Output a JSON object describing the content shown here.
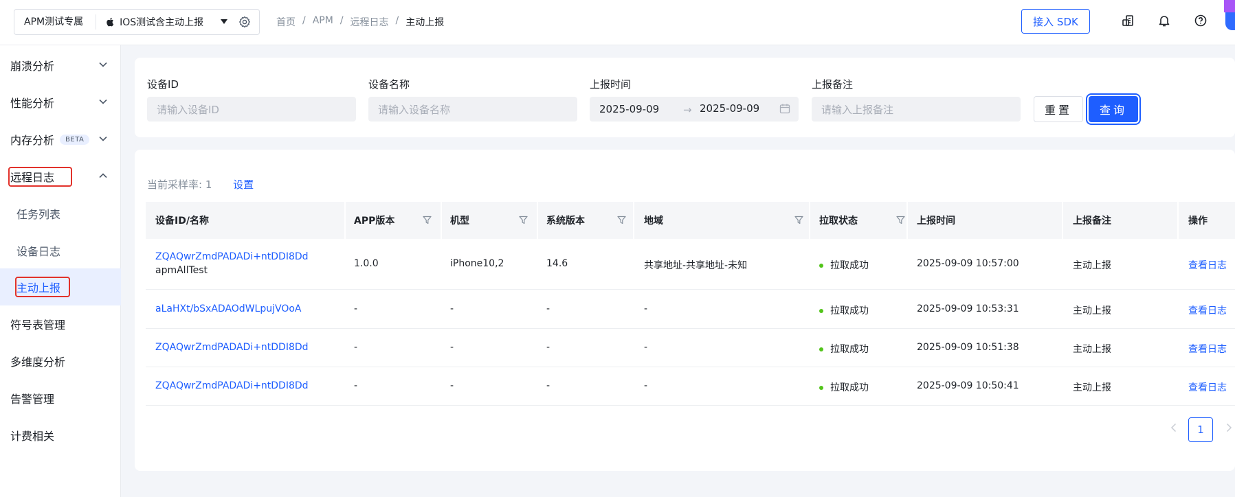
{
  "topbar": {
    "project": "APM测试专属",
    "app_name": "IOS测试含主动上报",
    "breadcrumbs": [
      "首页",
      "APM",
      "远程日志",
      "主动上报"
    ],
    "separator": "/",
    "sdk_button": "接入 SDK",
    "icons": [
      "coins-icon",
      "bell-icon",
      "help-icon"
    ]
  },
  "sidebar": {
    "items": [
      {
        "label": "崩溃分析",
        "expanded": false
      },
      {
        "label": "性能分析",
        "expanded": false
      },
      {
        "label": "内存分析",
        "badge": "BETA",
        "expanded": false
      },
      {
        "label": "远程日志",
        "expanded": true
      },
      {
        "label": "任务列表",
        "sub": true
      },
      {
        "label": "设备日志",
        "sub": true
      },
      {
        "label": "主动上报",
        "sub": true,
        "active": true
      },
      {
        "label": "符号表管理"
      },
      {
        "label": "多维度分析"
      },
      {
        "label": "告警管理"
      },
      {
        "label": "计费相关"
      }
    ]
  },
  "filter": {
    "device_id_label": "设备ID",
    "device_id_placeholder": "请输入设备ID",
    "device_name_label": "设备名称",
    "device_name_placeholder": "请输入设备名称",
    "time_label": "上报时间",
    "date_start": "2025-09-09",
    "date_arrow": "→",
    "date_end": "2025-09-09",
    "remark_label": "上报备注",
    "remark_placeholder": "请输入上报备注",
    "reset_button": "重置",
    "query_button": "查询"
  },
  "table": {
    "rate_label": "当前采样率:",
    "rate_value": "1",
    "rate_setting": "设置",
    "columns": [
      "设备ID/名称",
      "APP版本",
      "机型",
      "系统版本",
      "地域",
      "拉取状态",
      "上报时间",
      "上报备注",
      "操作"
    ],
    "rows": [
      {
        "device_id": "ZQAQwrZmdPADADi+ntDDI8Dd",
        "device_name": "apmAllTest",
        "app_version": "1.0.0",
        "model": "iPhone10,2",
        "os_version": "14.6",
        "region": "共享地址-共享地址-未知",
        "status": "拉取成功",
        "time": "2025-09-09 10:57:00",
        "remark": "主动上报",
        "action": "查看日志"
      },
      {
        "device_id": "aLaHXt/bSxADAOdWLpujVOoA",
        "device_name": "",
        "app_version": "-",
        "model": "-",
        "os_version": "-",
        "region": "-",
        "status": "拉取成功",
        "time": "2025-09-09 10:53:31",
        "remark": "主动上报",
        "action": "查看日志"
      },
      {
        "device_id": "ZQAQwrZmdPADADi+ntDDI8Dd",
        "device_name": "",
        "app_version": "-",
        "model": "-",
        "os_version": "-",
        "region": "-",
        "status": "拉取成功",
        "time": "2025-09-09 10:51:38",
        "remark": "主动上报",
        "action": "查看日志"
      },
      {
        "device_id": "ZQAQwrZmdPADADi+ntDDI8Dd",
        "device_name": "",
        "app_version": "-",
        "model": "-",
        "os_version": "-",
        "region": "-",
        "status": "拉取成功",
        "time": "2025-09-09 10:50:41",
        "remark": "主动上报",
        "action": "查看日志"
      }
    ]
  },
  "pagination": {
    "current": "1"
  },
  "colors": {
    "accent": "#1e5eff",
    "success": "#52c41a",
    "highlight_box": "#e2322b"
  }
}
